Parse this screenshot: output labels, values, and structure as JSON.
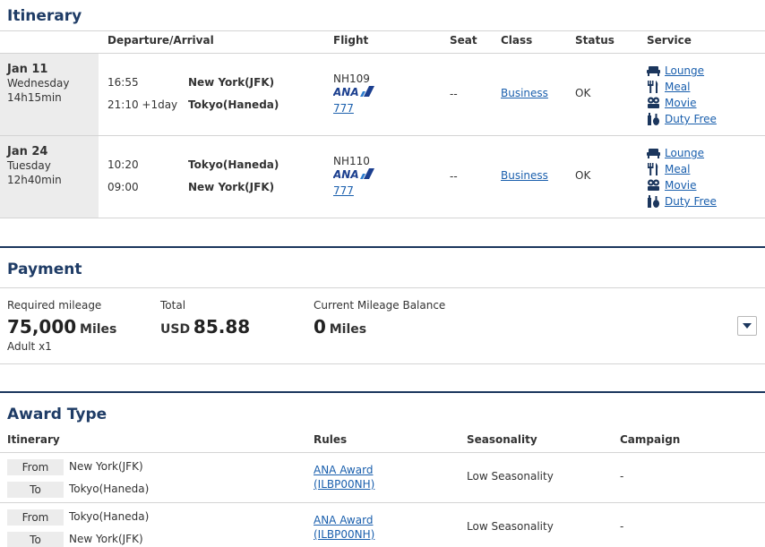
{
  "itinerary": {
    "title": "Itinerary",
    "headers": {
      "dep_arr": "Departure/Arrival",
      "flight": "Flight",
      "seat": "Seat",
      "class": "Class",
      "status": "Status",
      "service": "Service"
    },
    "segments": [
      {
        "date": "Jan 11",
        "weekday": "Wednesday",
        "duration": "14h15min",
        "dep_time": "16:55",
        "dep_city": "New York(JFK)",
        "arr_time": "21:10 +1day",
        "arr_city": "Tokyo(Haneda)",
        "flight_no": "NH109",
        "airline_logo": "ANA",
        "aircraft": "777",
        "seat": "--",
        "class": "Business",
        "status": "OK",
        "services": [
          "Lounge",
          "Meal",
          "Movie",
          "Duty Free"
        ]
      },
      {
        "date": "Jan 24",
        "weekday": "Tuesday",
        "duration": "12h40min",
        "dep_time": "10:20",
        "dep_city": "Tokyo(Haneda)",
        "arr_time": "09:00",
        "arr_city": "New York(JFK)",
        "flight_no": "NH110",
        "airline_logo": "ANA",
        "aircraft": "777",
        "seat": "--",
        "class": "Business",
        "status": "OK",
        "services": [
          "Lounge",
          "Meal",
          "Movie",
          "Duty Free"
        ]
      }
    ]
  },
  "payment": {
    "title": "Payment",
    "required_label": "Required mileage",
    "required_value": "75,000",
    "required_unit": "Miles",
    "passengers": "Adult x1",
    "total_label": "Total",
    "total_currency": "USD",
    "total_value": "85.88",
    "balance_label": "Current Mileage Balance",
    "balance_value": "0",
    "balance_unit": "Miles"
  },
  "award": {
    "title": "Award Type",
    "headers": {
      "itinerary": "Itinerary",
      "rules": "Rules",
      "seasonality": "Seasonality",
      "campaign": "Campaign"
    },
    "from_label": "From",
    "to_label": "To",
    "rows": [
      {
        "from": "New York(JFK)",
        "to": "Tokyo(Haneda)",
        "rule_line1": "ANA Award",
        "rule_line2": "(ILBP00NH)",
        "seasonality": "Low Seasonality",
        "campaign": "-"
      },
      {
        "from": "Tokyo(Haneda)",
        "to": "New York(JFK)",
        "rule_line1": "ANA Award",
        "rule_line2": "(ILBP00NH)",
        "seasonality": "Low Seasonality",
        "campaign": "-"
      }
    ]
  },
  "colors": {
    "heading": "#1f3c66",
    "link": "#1a5fad",
    "divider": "#1b365d",
    "date_bg": "#ececec"
  }
}
